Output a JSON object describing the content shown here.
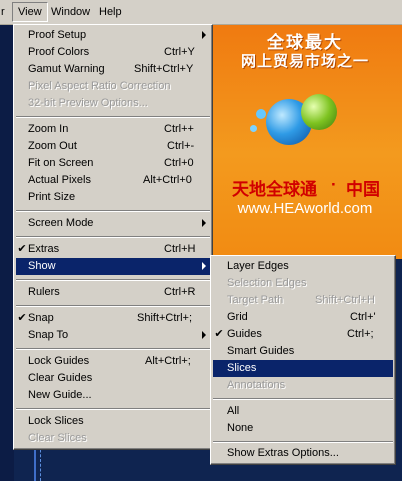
{
  "menubar": {
    "partial_label": "r",
    "view_label": "View",
    "window_label": "Window",
    "help_label": "Help"
  },
  "background": {
    "slogan_line1": "全球最大",
    "slogan_line2": "网上贸易市场之一",
    "brand_cn": "天地全球通",
    "brand_dot": "·",
    "brand_cn2": "中国",
    "url": "www.HEAworld.com"
  },
  "view_menu": {
    "proof_setup": "Proof Setup",
    "proof_colors": "Proof Colors",
    "proof_colors_sc": "Ctrl+Y",
    "gamut_warning": "Gamut Warning",
    "gamut_warning_sc": "Shift+Ctrl+Y",
    "pixel_aspect": "Pixel Aspect Ratio Correction",
    "preview_32": "32-bit Preview Options...",
    "zoom_in": "Zoom In",
    "zoom_in_sc": "Ctrl++",
    "zoom_out": "Zoom Out",
    "zoom_out_sc": "Ctrl+-",
    "fit_on_screen": "Fit on Screen",
    "fit_on_screen_sc": "Ctrl+0",
    "actual_pixels": "Actual Pixels",
    "actual_pixels_sc": "Alt+Ctrl+0",
    "print_size": "Print Size",
    "screen_mode": "Screen Mode",
    "extras": "Extras",
    "extras_sc": "Ctrl+H",
    "show": "Show",
    "rulers": "Rulers",
    "rulers_sc": "Ctrl+R",
    "snap": "Snap",
    "snap_sc": "Shift+Ctrl+;",
    "snap_to": "Snap To",
    "lock_guides": "Lock Guides",
    "lock_guides_sc": "Alt+Ctrl+;",
    "clear_guides": "Clear Guides",
    "new_guide": "New Guide...",
    "lock_slices": "Lock Slices",
    "clear_slices": "Clear Slices",
    "check": "✔"
  },
  "show_menu": {
    "layer_edges": "Layer Edges",
    "selection_edges": "Selection Edges",
    "target_path": "Target Path",
    "target_path_sc": "Shift+Ctrl+H",
    "grid": "Grid",
    "grid_sc": "Ctrl+'",
    "guides": "Guides",
    "guides_sc": "Ctrl+;",
    "smart_guides": "Smart Guides",
    "slices": "Slices",
    "annotations": "Annotations",
    "all": "All",
    "none": "None",
    "show_extras_options": "Show Extras Options..."
  },
  "colors": {
    "menu_bg": "#d4d0c8",
    "highlight": "#0a246a",
    "banner_orange": "#f39a1e",
    "brand_red": "#d10000"
  }
}
